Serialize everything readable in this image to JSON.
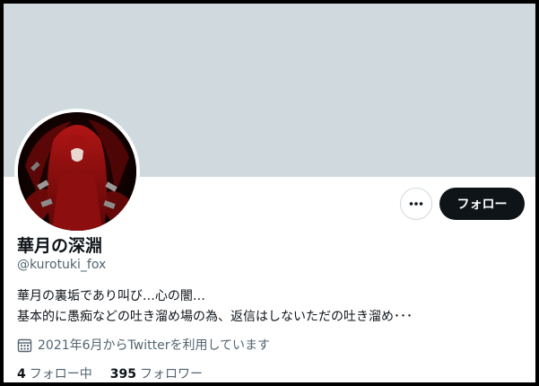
{
  "profile": {
    "display_name": "華月の深淵",
    "handle": "@kurotuki_fox",
    "bio_lines": [
      "華月の裏垢であり叫び…心の闇…",
      "基本的に愚痴などの吐き溜め場の為、返信はしないただの吐き溜め･･･"
    ],
    "joined": "2021年6月からTwitterを利用しています",
    "following_count": "4",
    "following_label": "フォロー中",
    "followers_count": "395",
    "followers_label": "フォロワー"
  },
  "actions": {
    "follow_label": "フォロー",
    "more_icon": "more-horizontal-icon"
  },
  "icons": {
    "joined": "calendar-icon"
  },
  "colors": {
    "banner": "#cfd9de",
    "primary_text": "#0f1419",
    "secondary_text": "#536471",
    "follow_button_bg": "#0f1419",
    "frame_border": "#000000"
  }
}
